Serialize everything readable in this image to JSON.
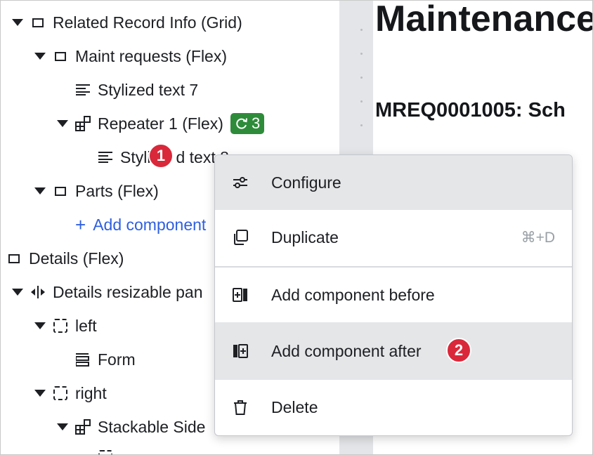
{
  "tree": {
    "items": [
      {
        "label": "Related Record Info (Grid)"
      },
      {
        "label": "Maint requests (Flex)"
      },
      {
        "label": "Stylized text 7"
      },
      {
        "label": "Repeater 1 (Flex)",
        "badge": "3"
      },
      {
        "label": "Styli"
      },
      {
        "label": "d text 8"
      },
      {
        "label": "Parts (Flex)"
      },
      {
        "label": "Add component"
      },
      {
        "label": "Details (Flex)"
      },
      {
        "label": "Details resizable pan"
      },
      {
        "label": "left"
      },
      {
        "label": "Form"
      },
      {
        "label": "right"
      },
      {
        "label": "Stackable Side"
      }
    ]
  },
  "content": {
    "heading": "Maintenance",
    "subheading": "MREQ0001005: Sch"
  },
  "menu": {
    "configure": "Configure",
    "duplicate": "Duplicate",
    "duplicate_shortcut": "⌘+D",
    "add_before": "Add component before",
    "add_after": "Add component after",
    "delete": "Delete"
  },
  "markers": {
    "one": "1",
    "two": "2"
  },
  "colors": {
    "accent": "#2f5fe0",
    "badge": "#2e8b3a",
    "marker": "#d9283a",
    "highlight": "#e5e6e8"
  }
}
